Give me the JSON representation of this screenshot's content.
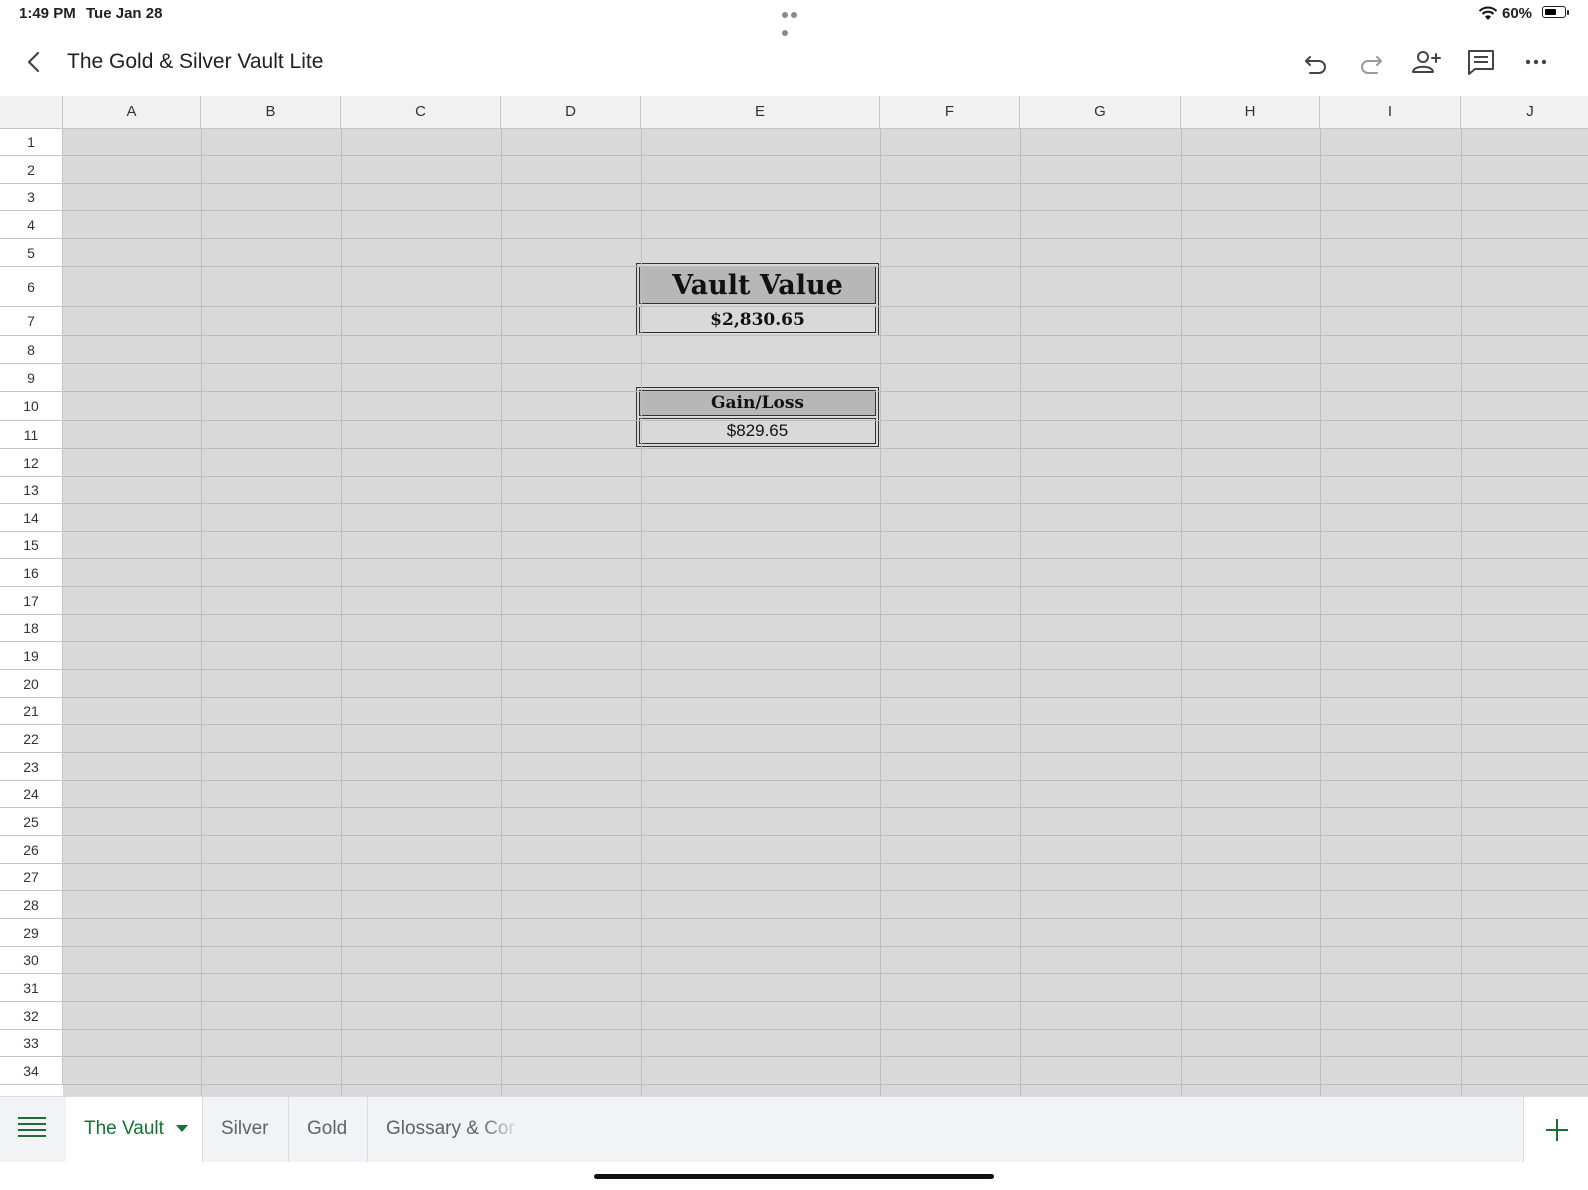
{
  "status_bar": {
    "time": "1:49 PM",
    "date": "Tue Jan 28",
    "battery_percent": "60%",
    "battery_level": 0.6
  },
  "header": {
    "title": "The Gold & Silver Vault Lite",
    "icons": [
      "back-arrow-icon",
      "undo-icon",
      "redo-icon",
      "add-person-icon",
      "comment-icon",
      "more-icon"
    ]
  },
  "columns": [
    "A",
    "B",
    "C",
    "D",
    "E",
    "F",
    "G",
    "H",
    "I",
    "J"
  ],
  "rows": [
    "1",
    "2",
    "3",
    "4",
    "5",
    "6",
    "7",
    "8",
    "9",
    "10",
    "11",
    "12",
    "13",
    "14",
    "15",
    "16",
    "17",
    "18",
    "19",
    "20",
    "21",
    "22",
    "23",
    "24",
    "25",
    "26",
    "27",
    "28",
    "29",
    "30",
    "31",
    "32",
    "33",
    "34"
  ],
  "vault": {
    "title": "Vault Value",
    "value": "$2,830.65",
    "gain_title": "Gain/Loss",
    "gain_value": "$829.65"
  },
  "sheet_tabs": {
    "tabs": [
      "The Vault",
      "Silver",
      "Gold",
      "Glossary & Cor"
    ],
    "active": "The Vault"
  },
  "colors": {
    "accent": "#137333",
    "cell_fill": "#d9d9d9",
    "header_fill": "#b7b7b7"
  }
}
